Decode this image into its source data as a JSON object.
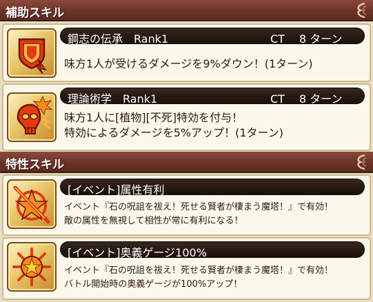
{
  "sections": {
    "support": {
      "title": "補助スキル"
    },
    "trait": {
      "title": "特性スキル"
    }
  },
  "skills": [
    {
      "name": "鋼志の伝承　Rank1",
      "ct": "CT　 8 ターン",
      "icon": "shield-arrow-down-icon",
      "desc": [
        "味方1人が受けるダメージを9%ダウン！(1ターン)"
      ]
    },
    {
      "name": "理論術学　Rank1",
      "ct": "CT　 8 ターン",
      "icon": "skull-burst-icon",
      "desc": [
        "味方1人に[植物][不死]特効を付与！",
        "特効によるダメージを5%アップ！(1ターン)"
      ]
    }
  ],
  "traits": [
    {
      "name": "[イベント]属性有利",
      "icon": "sigil-star-icon",
      "desc": [
        "イベント『石の呪詛を祓え！死せる賢者が棲まう魔塔！』で有効！",
        "敵の属性を無視して相性が常に有利になる！"
      ]
    },
    {
      "name": "[イベント]奥義ゲージ100%",
      "icon": "sun-sigil-icon",
      "desc": [
        "イベント『石の呪詛を祓え！死せる賢者が棲まう魔塔！』で有効！",
        "バトル開始時の奥義ゲージが100%アップ！"
      ]
    }
  ],
  "colors": {
    "header_bg": "#6e3328",
    "card_bg": "#fbf7ea",
    "name_bar_bg": "#251810",
    "icon_red": "#e23b10",
    "icon_orange": "#ff8a1c"
  }
}
